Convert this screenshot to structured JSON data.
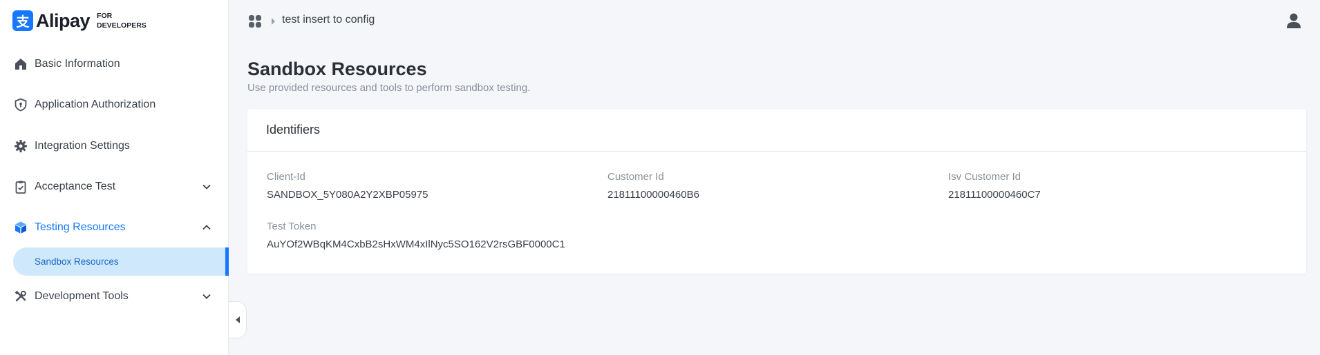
{
  "logo": {
    "glyph": "支",
    "name": "Alipay",
    "sub_line1": "FOR",
    "sub_line2": "DEVELOPERS",
    "brand_color": "#1677ff"
  },
  "sidebar": {
    "items": [
      {
        "label": "Basic Information",
        "icon": "home-icon"
      },
      {
        "label": "Application Authorization",
        "icon": "shield-icon"
      },
      {
        "label": "Integration Settings",
        "icon": "gear-icon"
      },
      {
        "label": "Acceptance Test",
        "icon": "clipboard-check-icon",
        "chevron": "down"
      },
      {
        "label": "Testing Resources",
        "icon": "cube-icon",
        "chevron": "up",
        "active": true
      },
      {
        "label": "Development Tools",
        "icon": "tools-icon",
        "chevron": "down"
      }
    ],
    "sub_items": [
      {
        "label": "Sandbox Resources",
        "active": true
      }
    ]
  },
  "topbar": {
    "breadcrumb": "test insert to config"
  },
  "main": {
    "title": "Sandbox Resources",
    "subtitle": "Use provided resources and tools to perform sandbox testing.",
    "card": {
      "title": "Identifiers",
      "fields": [
        {
          "label": "Client-Id",
          "value": "SANDBOX_5Y080A2Y2XBP05975"
        },
        {
          "label": "Customer Id",
          "value": "21811100000460B6"
        },
        {
          "label": "Isv Customer Id",
          "value": "21811100000460C7"
        },
        {
          "label": "Test Token",
          "value": "AuYOf2WBqKM4CxbB2sHxWM4xIlNyc5SO162V2rsGBF0000C1"
        }
      ]
    }
  },
  "colors": {
    "accent": "#1677ff",
    "active_bg": "#cfe8fb",
    "page_bg": "#f4f6f9"
  }
}
